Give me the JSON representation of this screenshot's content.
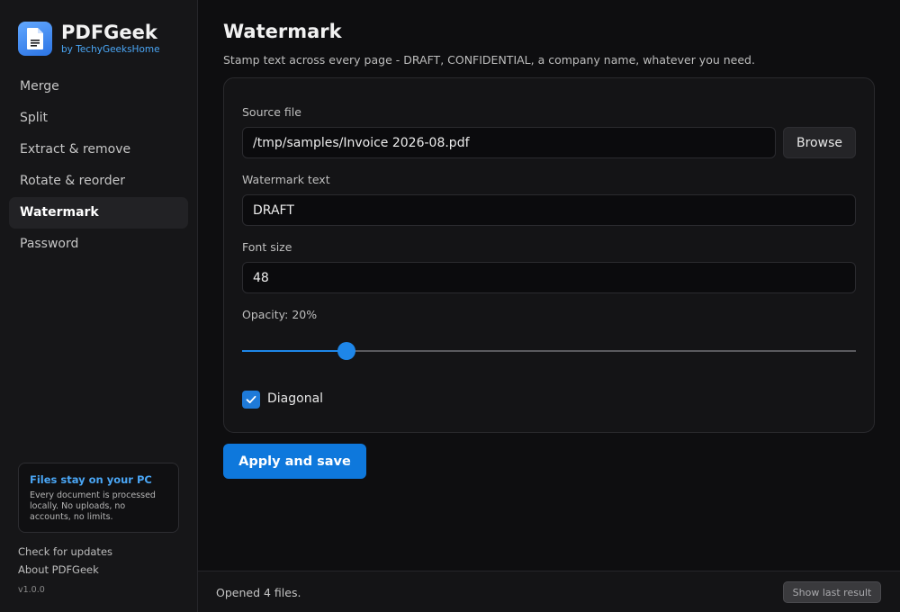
{
  "app": {
    "name": "PDFGeek",
    "subtitle": "by TechyGeeksHome",
    "logo_icon": "document-icon",
    "accent_color": "#1e86e8"
  },
  "sidebar": {
    "items": [
      {
        "label": "Merge",
        "active": false
      },
      {
        "label": "Split",
        "active": false
      },
      {
        "label": "Extract & remove",
        "active": false
      },
      {
        "label": "Rotate & reorder",
        "active": false
      },
      {
        "label": "Watermark",
        "active": true
      },
      {
        "label": "Password",
        "active": false
      }
    ],
    "notice": {
      "title": "Files stay on your PC",
      "body": "Every document is processed locally. No uploads, no accounts, no limits."
    },
    "links": {
      "updates": "Check for updates",
      "about": "About PDFGeek"
    },
    "version": "v1.0.0"
  },
  "main": {
    "title": "Watermark",
    "description": "Stamp text across every page - DRAFT, CONFIDENTIAL, a company name, whatever you need.",
    "form": {
      "source_label": "Source file",
      "source_value": "/tmp/samples/Invoice 2026-08.pdf",
      "browse_label": "Browse",
      "text_label": "Watermark text",
      "text_value": "DRAFT",
      "size_label": "Font size",
      "size_value": "48",
      "opacity_label": "Opacity: 20%",
      "opacity_fraction": 0.17,
      "diagonal_label": "Diagonal",
      "diagonal_checked": true
    },
    "apply_label": "Apply and save"
  },
  "status": {
    "text": "Opened 4 files.",
    "last_result_label": "Show last result"
  }
}
